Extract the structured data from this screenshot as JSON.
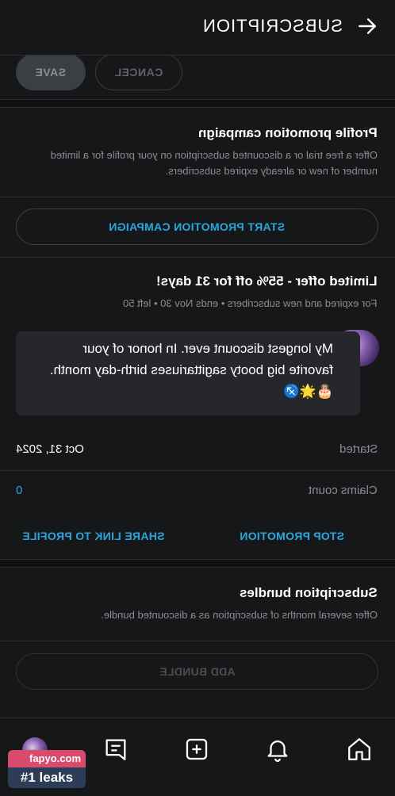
{
  "header": {
    "title": "SUBSCRIPTION"
  },
  "actions": {
    "save_label": "SAVE",
    "cancel_label": "CANCEL"
  },
  "promo_campaign": {
    "title": "Profile promotion campaign",
    "description": "Offer a free trial or a discounted subscription on your profile for a limited number of new or already expired subscribers.",
    "start_label": "START PROMOTION CAMPAIGN"
  },
  "offer": {
    "title": "Limited offer - 55% off for 31 days!",
    "meta": "For expired and new subscribers  •  ends Nov 30  •  left 50",
    "message": "My longest discount ever. In honor of your favorite big booty sagittariuses birth-day month. 🎂🌟♐️",
    "started_label": "Started",
    "started_value": "Oct 31, 2024",
    "claims_label": "Claims count",
    "claims_value": "0",
    "stop_label": "STOP PROMOTION",
    "share_label": "SHARE LINK TO PROFILE"
  },
  "bundles": {
    "title": "Subscription bundles",
    "description": "Offer several months of subscription as a discounted bundle.",
    "add_label": "ADD BUNDLE"
  },
  "nav": {
    "items": [
      "home-icon",
      "bell-icon",
      "add-post-icon",
      "messages-icon",
      "profile-avatar"
    ]
  },
  "watermark": {
    "top": "fapyo.com",
    "bottom": "#1 leaks"
  },
  "colors": {
    "accent": "#28a7e0",
    "background": "#161719",
    "muted": "#8a8d92"
  }
}
